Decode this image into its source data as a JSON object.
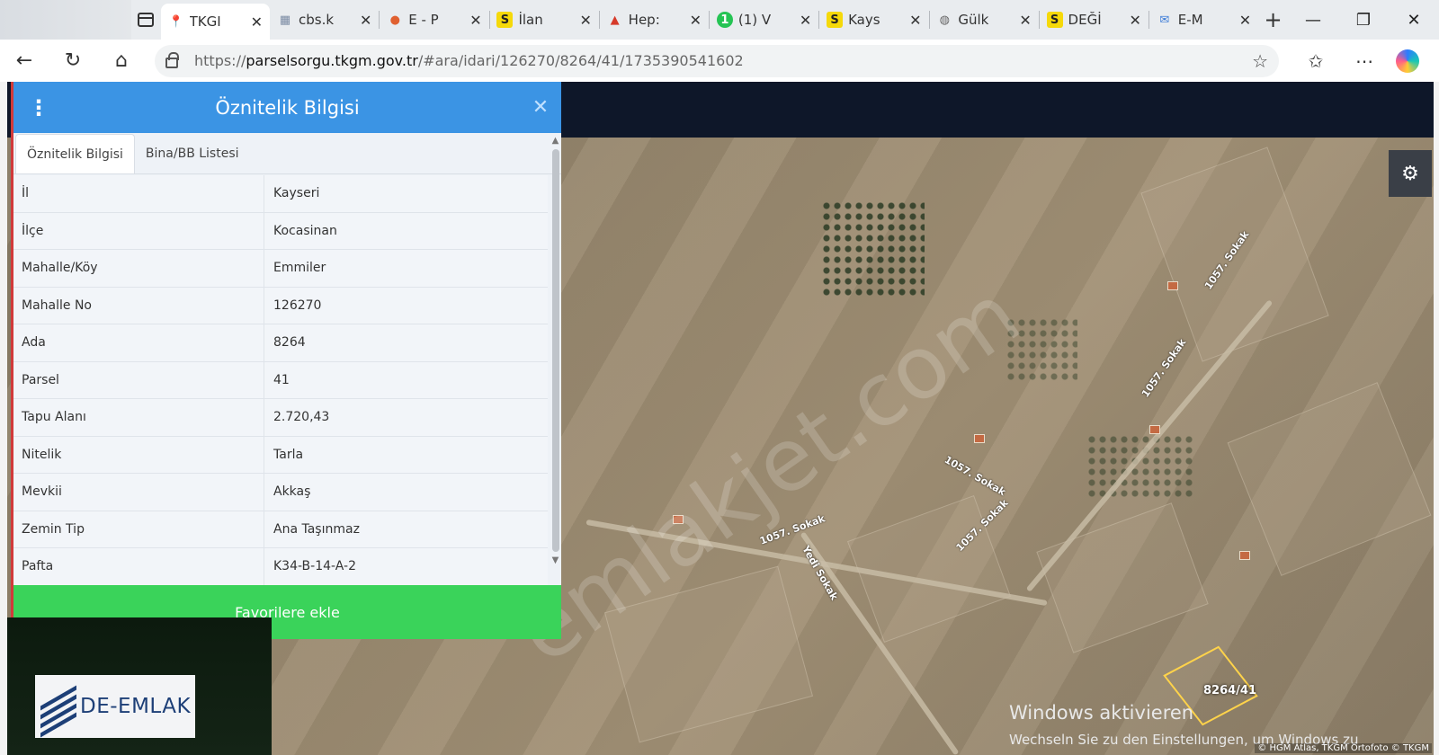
{
  "browser": {
    "tabs": [
      {
        "favicon": "map-pin",
        "title": "TKGI",
        "active": true
      },
      {
        "favicon": "cbs",
        "title": "cbs.k"
      },
      {
        "favicon": "e-logo",
        "title": "E - P"
      },
      {
        "favicon": "S",
        "title": "İlan"
      },
      {
        "favicon": "hepsi",
        "title": "Hep:"
      },
      {
        "favicon": "1",
        "title": "(1) V"
      },
      {
        "favicon": "S",
        "title": "Kays"
      },
      {
        "favicon": "globe",
        "title": "Gülk"
      },
      {
        "favicon": "S",
        "title": "DEĞİ"
      },
      {
        "favicon": "mail",
        "title": "E-M"
      }
    ],
    "url_prefix": "https://",
    "url_domain": "parselsorgu.tkgm.gov.tr",
    "url_path": "/#ara/idari/126270/8264/41/1735390541602"
  },
  "panel": {
    "title": "Öznitelik Bilgisi",
    "tabs": [
      "Öznitelik Bilgisi",
      "Bina/BB Listesi"
    ],
    "rows": [
      {
        "key": "İl",
        "value": "Kayseri"
      },
      {
        "key": "İlçe",
        "value": "Kocasinan"
      },
      {
        "key": "Mahalle/Köy",
        "value": "Emmiler"
      },
      {
        "key": "Mahalle No",
        "value": "126270"
      },
      {
        "key": "Ada",
        "value": "8264"
      },
      {
        "key": "Parsel",
        "value": "41"
      },
      {
        "key": "Tapu Alanı",
        "value": "2.720,43"
      },
      {
        "key": "Nitelik",
        "value": "Tarla"
      },
      {
        "key": "Mevkii",
        "value": "Akkaş"
      },
      {
        "key": "Zemin Tip",
        "value": "Ana Taşınmaz"
      },
      {
        "key": "Pafta",
        "value": "K34-B-14-A-2"
      }
    ],
    "favorite_button": "Favorilere ekle"
  },
  "map": {
    "parcel_label": "8264/41",
    "road_labels": [
      "1057. Sokak",
      "1057. Sokak",
      "1057. Sokak",
      "1057. Sokak",
      "1057. Sokak",
      "Yedi Sokak"
    ],
    "watermark": "emlakjet.com",
    "activation_title": "Windows aktivieren",
    "activation_text": "Wechseln Sie zu den Einstellungen, um Windows zu aktivieren.",
    "attribution": "© HGM Atlas, TKGM Ortofoto © TKGM"
  },
  "logo": {
    "text": "DE-EMLAK"
  },
  "colors": {
    "panel_header": "#3b94e4",
    "favorite_button": "#3ad35a",
    "parcel_outline": "#ffd34a"
  }
}
